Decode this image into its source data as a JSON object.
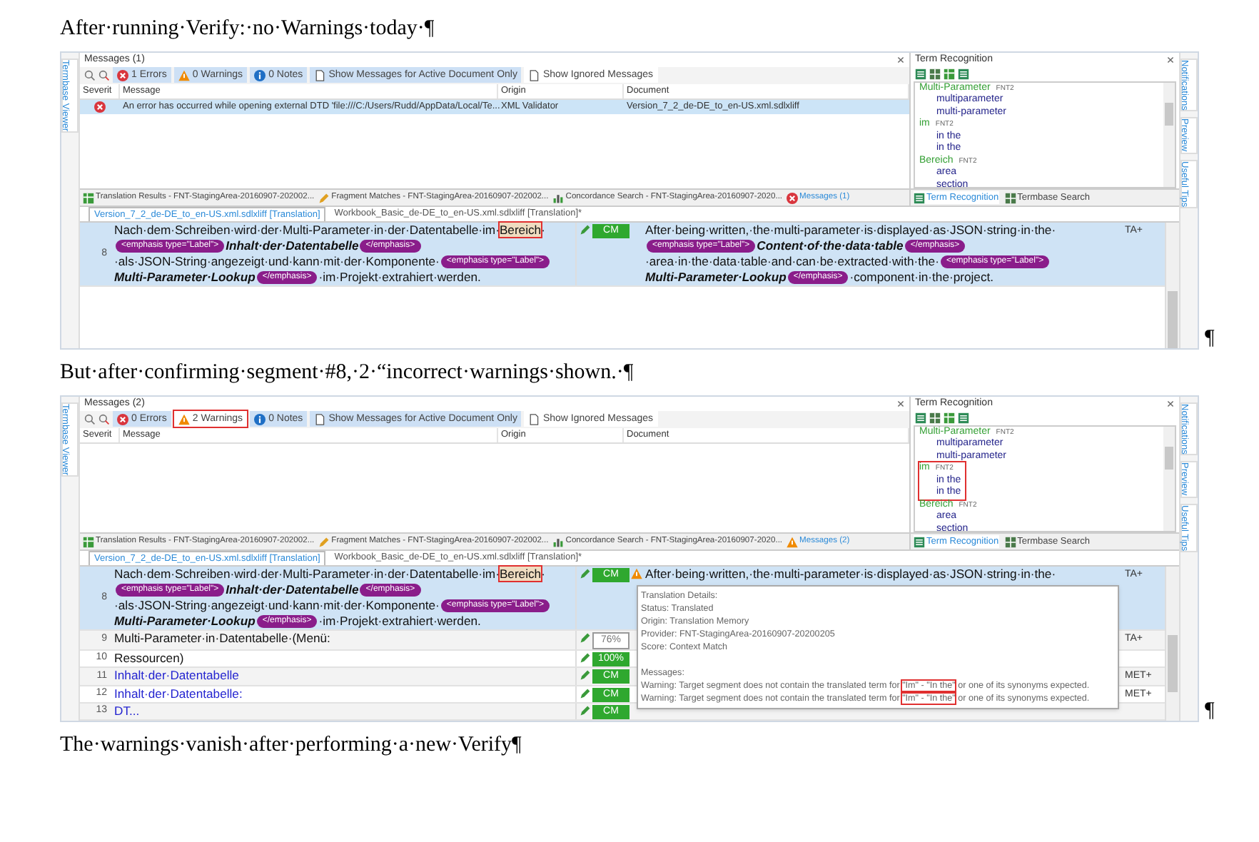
{
  "document": {
    "blocks": [
      {
        "kind": "paragraph",
        "text": "After·running·Verify:·no·Warnings·today·¶"
      },
      {
        "kind": "screenshot",
        "trailing_mark": "¶",
        "left_strip": [
          "Termbase Viewer"
        ],
        "right_strip": [
          "Notifications",
          "Preview",
          "Useful Tips"
        ],
        "messages": {
          "title": "Messages (1)",
          "toolbar": [
            {
              "kind": "error",
              "label": "1 Errors",
              "selected": true,
              "highlighted": false
            },
            {
              "kind": "warning",
              "label": "0 Warnings",
              "selected": true,
              "highlighted": false
            },
            {
              "kind": "note",
              "label": "0 Notes",
              "selected": true,
              "highlighted": false
            },
            {
              "kind": "page",
              "label": "Show Messages for Active Document Only",
              "selected": true,
              "highlighted": false
            },
            {
              "kind": "page",
              "label": "Show Ignored Messages",
              "selected": false,
              "highlighted": false
            }
          ],
          "columns": [
            "Severit",
            "Message",
            "Origin",
            "Document"
          ],
          "rows": [
            {
              "kind": "error",
              "message": "An error has occurred while opening external DTD 'file:///C:/Users/Rudd/AppData/Local/Te...",
              "origin": "XML Validator",
              "document": "Version_7_2_de-DE_to_en-US.xml.sdlxliff",
              "selected": true
            }
          ],
          "tabs": [
            {
              "kind": "results",
              "label": "Translation Results - FNT-StagingArea-20160907-202002..."
            },
            {
              "kind": "fragment",
              "label": "Fragment Matches - FNT-StagingArea-20160907-202002..."
            },
            {
              "kind": "concordance",
              "label": "Concordance Search - FNT-StagingArea-20160907-2020..."
            },
            {
              "kind": "error",
              "label": "Messages (1)"
            }
          ]
        },
        "terms": {
          "title": "Term Recognition",
          "entries": [
            {
              "term": "Multi-Parameter",
              "tag": "FNT2",
              "highlighted": false,
              "children": [
                {
                  "label": "multiparameter"
                },
                {
                  "label": "multi-parameter"
                }
              ]
            },
            {
              "term": "im",
              "tag": "FNT2",
              "highlighted": false,
              "children": [
                {
                  "label": "in the"
                },
                {
                  "label": "in the"
                }
              ]
            },
            {
              "term": "Bereich",
              "tag": "FNT2",
              "highlighted": false,
              "children": [
                {
                  "label": "area"
                },
                {
                  "label": "section"
                }
              ]
            }
          ],
          "tabs": [
            {
              "kind": "terms",
              "label": "Term Recognition",
              "selected": true
            },
            {
              "kind": "termbase",
              "label": "Termbase Search",
              "selected": false
            }
          ]
        },
        "editor_tabs": [
          {
            "label": "Version_7_2_de-DE_to_en-US.xml.sdlxliff [Translation]",
            "selected": true
          },
          {
            "label": "Workbook_Basic_de-DE_to_en-US.xml.sdlxliff [Translation]*",
            "selected": false
          }
        ],
        "segments": [
          {
            "number": "8",
            "selected": true,
            "status": "CM",
            "kind": "cm",
            "warning": false,
            "flag": "TA+",
            "source": [
              {
                "kind": "text",
                "text": "Nach·dem·Schreiben·wird·der·Multi-Parameter·in·der·Datentabelle·im·"
              },
              {
                "kind": "marked",
                "text": "Bereich"
              },
              {
                "kind": "text",
                "text": "·"
              },
              {
                "kind": "tag",
                "text": "<emphasis type=\"Label\">"
              },
              {
                "kind": "term",
                "text": "Inhalt·der·Datentabelle"
              },
              {
                "kind": "tag",
                "text": "</emphasis>"
              },
              {
                "kind": "text",
                "text": "·als·JSON-String·angezeigt·und·kann·mit·der·Komponente·"
              },
              {
                "kind": "tag",
                "text": "<emphasis type=\"Label\">"
              },
              {
                "kind": "term",
                "text": "Multi-Parameter·Lookup"
              },
              {
                "kind": "tag",
                "text": "</emphasis>"
              },
              {
                "kind": "text",
                "text": "·im·Projekt·extrahiert·werden."
              }
            ],
            "target": [
              {
                "kind": "text",
                "text": "After·being·written,·the·multi-parameter·is·displayed·as·JSON·string·in·the·"
              },
              {
                "kind": "tag",
                "text": "<emphasis type=\"Label\">"
              },
              {
                "kind": "term",
                "text": "Content·of·the·data·table"
              },
              {
                "kind": "tag",
                "text": "</emphasis>"
              },
              {
                "kind": "text",
                "text": "·area·in·the·data·table·and·can·be·extracted·with·the·"
              },
              {
                "kind": "tag",
                "text": "<emphasis type=\"Label\">"
              },
              {
                "kind": "term",
                "text": "Multi-Parameter·Lookup"
              },
              {
                "kind": "tag",
                "text": "</emphasis>"
              },
              {
                "kind": "text",
                "text": "·component·in·the·project."
              }
            ]
          }
        ]
      },
      {
        "kind": "paragraph",
        "text": "But·after·confirming·segment·#8,·2·“incorrect·warnings·shown.·¶"
      },
      {
        "kind": "screenshot",
        "trailing_mark": "¶",
        "left_strip": [
          "Termbase Viewer"
        ],
        "right_strip": [
          "Notifications",
          "Preview",
          "Useful Tips"
        ],
        "messages": {
          "title": "Messages (2)",
          "toolbar": [
            {
              "kind": "error",
              "label": "0 Errors",
              "selected": true,
              "highlighted": false
            },
            {
              "kind": "warning",
              "label": "2 Warnings",
              "selected": false,
              "highlighted": true
            },
            {
              "kind": "note",
              "label": "0 Notes",
              "selected": true,
              "highlighted": false
            },
            {
              "kind": "page",
              "label": "Show Messages for Active Document Only",
              "selected": true,
              "highlighted": false
            },
            {
              "kind": "page",
              "label": "Show Ignored Messages",
              "selected": false,
              "highlighted": false
            }
          ],
          "columns": [
            "Severit",
            "Message",
            "Origin",
            "Document"
          ],
          "tabs": [
            {
              "kind": "results",
              "label": "Translation Results - FNT-StagingArea-20160907-202002..."
            },
            {
              "kind": "fragment",
              "label": "Fragment Matches - FNT-StagingArea-20160907-202002..."
            },
            {
              "kind": "concordance",
              "label": "Concordance Search - FNT-StagingArea-20160907-2020..."
            },
            {
              "kind": "warning",
              "label": "Messages (2)"
            }
          ]
        },
        "terms": {
          "title": "Term Recognition",
          "entries": [
            {
              "term": "Multi-Parameter",
              "tag": "FNT2",
              "highlighted": false,
              "children": [
                {
                  "label": "multiparameter"
                },
                {
                  "label": "multi-parameter"
                }
              ]
            },
            {
              "term": "im",
              "tag": "FNT2",
              "highlighted": true,
              "children": [
                {
                  "label": "in the"
                },
                {
                  "label": "in the"
                }
              ]
            },
            {
              "term": "Bereich",
              "tag": "FNT2",
              "highlighted": false,
              "children": [
                {
                  "label": "area"
                },
                {
                  "label": "section"
                }
              ]
            }
          ],
          "tabs": [
            {
              "kind": "terms",
              "label": "Term Recognition",
              "selected": true
            },
            {
              "kind": "termbase",
              "label": "Termbase Search",
              "selected": false
            }
          ]
        },
        "editor_tabs": [
          {
            "label": "Version_7_2_de-DE_to_en-US.xml.sdlxliff [Translation]",
            "selected": true
          },
          {
            "label": "Workbook_Basic_de-DE_to_en-US.xml.sdlxliff [Translation]*",
            "selected": false
          }
        ],
        "segments": [
          {
            "number": "8",
            "selected": true,
            "status": "CM",
            "kind": "cm",
            "warning": true,
            "flag": "TA+",
            "source": [
              {
                "kind": "text",
                "text": "Nach·dem·Schreiben·wird·der·Multi-Parameter·in·der·Datentabelle·im·"
              },
              {
                "kind": "marked",
                "text": "Bereich"
              },
              {
                "kind": "text",
                "text": "·"
              },
              {
                "kind": "tag",
                "text": "<emphasis type=\"Label\">"
              },
              {
                "kind": "term",
                "text": "Inhalt·der·Datentabelle"
              },
              {
                "kind": "tag",
                "text": "</emphasis>"
              },
              {
                "kind": "text",
                "text": "·als·JSON-String·angezeigt·und·kann·mit·der·Komponente·"
              },
              {
                "kind": "tag",
                "text": "<emphasis type=\"Label\">"
              },
              {
                "kind": "term",
                "text": "Multi-Parameter·Lookup"
              },
              {
                "kind": "tag",
                "text": "</emphasis>"
              },
              {
                "kind": "text",
                "text": "·im·Projekt·extrahiert·werden."
              }
            ],
            "target": [
              {
                "kind": "text",
                "text": "After·being·written,·the·multi-parameter·is·displayed·as·JSON·string·in·the·"
              }
            ],
            "tooltip": {
              "details": [
                [
                  {
                    "kind": "text",
                    "text": "Translation Details:"
                  }
                ],
                [
                  {
                    "kind": "text",
                    "text": "Status: Translated"
                  }
                ],
                [
                  {
                    "kind": "text",
                    "text": "Origin: Translation Memory"
                  }
                ],
                [
                  {
                    "kind": "text",
                    "text": "Provider: FNT-StagingArea-20160907-20200205"
                  }
                ],
                [
                  {
                    "kind": "text",
                    "text": "Score: Context Match"
                  }
                ]
              ],
              "messages": [
                [
                  {
                    "kind": "text",
                    "text": "Messages:"
                  }
                ],
                [
                  {
                    "kind": "text",
                    "text": "Warning: Target segment does not contain the translated term for "
                  },
                  {
                    "kind": "boxed",
                    "text": "\"Im\" - \"In the\""
                  },
                  {
                    "kind": "text",
                    "text": " or one of its synonyms expected."
                  }
                ],
                [
                  {
                    "kind": "text",
                    "text": "Warning: Target segment does not contain the translated term for "
                  },
                  {
                    "kind": "boxed",
                    "text": "\"Im\" - \"In the\""
                  },
                  {
                    "kind": "text",
                    "text": " or one of its synonyms expected."
                  }
                ]
              ]
            }
          },
          {
            "number": "9",
            "selected": false,
            "status": "76%",
            "kind": "fuzzy",
            "warning": false,
            "flag": "TA+",
            "source": [
              {
                "kind": "text",
                "text": "Multi-Parameter·in·Datentabelle·(Menü:"
              }
            ]
          },
          {
            "number": "10",
            "selected": false,
            "status": "100%",
            "kind": "exact",
            "warning": false,
            "source": [
              {
                "kind": "text",
                "text": "Ressourcen)"
              }
            ]
          },
          {
            "number": "11",
            "selected": false,
            "status": "CM",
            "kind": "cm",
            "warning": false,
            "flag": "MET+",
            "source": [
              {
                "kind": "linked",
                "text": "Inhalt·der·Datentabelle"
              }
            ]
          },
          {
            "number": "12",
            "selected": false,
            "status": "CM",
            "kind": "cm",
            "warning": false,
            "flag": "MET+",
            "source": [
              {
                "kind": "linked",
                "text": "Inhalt·der·Datentabelle:"
              }
            ]
          },
          {
            "number": "13",
            "selected": false,
            "status": "CM",
            "kind": "cm",
            "warning": false,
            "source": [
              {
                "kind": "linked",
                "text": "DT..."
              }
            ]
          }
        ]
      },
      {
        "kind": "paragraph",
        "text": "The·warnings·vanish·after·performing·a·new·Verify¶"
      }
    ]
  }
}
